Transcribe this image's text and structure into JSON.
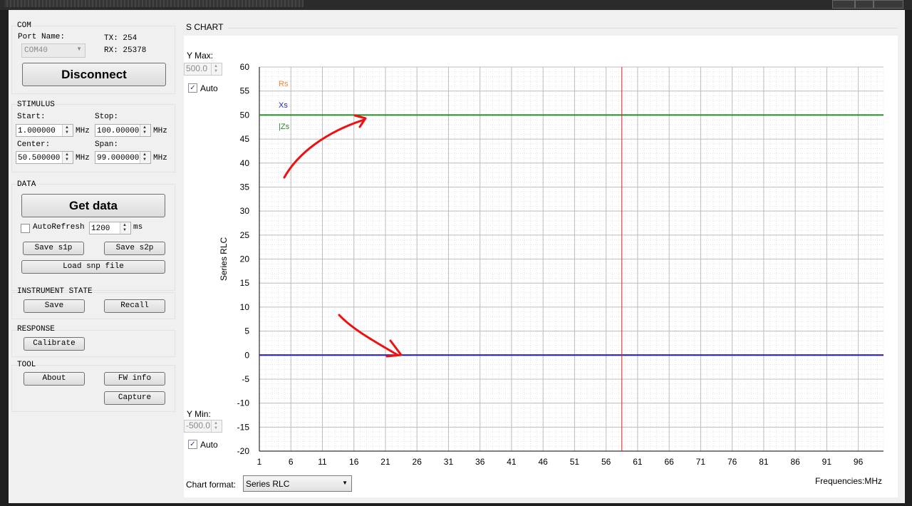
{
  "com": {
    "heading": "COM",
    "port_label": "Port Name:",
    "port_value": "COM40",
    "tx": "TX: 254",
    "rx": "RX: 25378",
    "disconnect": "Disconnect"
  },
  "stimulus": {
    "heading": "STIMULUS",
    "start_label": "Start:",
    "start_value": "1.000000",
    "stop_label": "Stop:",
    "stop_value": "100.000000",
    "center_label": "Center:",
    "center_value": "50.500000",
    "span_label": "Span:",
    "span_value": "99.000000",
    "unit": "MHz"
  },
  "data_group": {
    "heading": "DATA",
    "get_data": "Get data",
    "autorefresh_label": "AutoRefresh",
    "autorefresh_checked": false,
    "interval_value": "1200",
    "interval_unit": "ms",
    "save_s1p": "Save s1p",
    "save_s2p": "Save s2p",
    "load_snp": "Load snp file"
  },
  "instrument_state": {
    "heading": "INSTRUMENT STATE",
    "save": "Save",
    "recall": "Recall"
  },
  "response": {
    "heading": "RESPONSE",
    "calibrate": "Calibrate"
  },
  "tool": {
    "heading": "TOOL",
    "about": "About",
    "fw_info": "FW info",
    "capture": "Capture"
  },
  "chart_panel": {
    "title": "S CHART",
    "ymax_label": "Y Max:",
    "ymax_value": "500.0",
    "ymax_auto_label": "Auto",
    "ymax_auto": true,
    "ymin_label": "Y Min:",
    "ymin_value": "-500.0",
    "ymin_auto_label": "Auto",
    "ymin_auto": true,
    "format_label": "Chart format:",
    "format_value": "Series RLC"
  },
  "colors": {
    "rs": "#f0883a",
    "xs": "#1f1fd0",
    "zs": "#2a8a2a",
    "marker": "#e01818",
    "annotation": "#ee1111"
  },
  "chart_data": {
    "type": "line",
    "ylabel": "Series RLC",
    "xlabel": "Frequencies:MHz",
    "xlim": [
      1,
      100
    ],
    "ylim": [
      -20,
      60
    ],
    "x_ticks": [
      "1",
      "6",
      "11",
      "16",
      "21",
      "26",
      "31",
      "36",
      "41",
      "46",
      "51",
      "56",
      "61",
      "66",
      "71",
      "76",
      "81",
      "86",
      "91",
      "96"
    ],
    "y_ticks": [
      "60",
      "55",
      "50",
      "45",
      "40",
      "35",
      "30",
      "25",
      "20",
      "15",
      "10",
      "5",
      "0",
      "-5",
      "-10",
      "-15",
      "-20"
    ],
    "grid": true,
    "legend_position": "top-left",
    "marker_x": 58.5,
    "series": [
      {
        "name": "Rs",
        "x": [
          1,
          100
        ],
        "values": [
          0,
          0
        ]
      },
      {
        "name": "Xs",
        "x": [
          1,
          100
        ],
        "values": [
          0,
          0
        ]
      },
      {
        "name": "|Zs",
        "x": [
          1,
          100
        ],
        "values": [
          50,
          50
        ]
      }
    ]
  }
}
